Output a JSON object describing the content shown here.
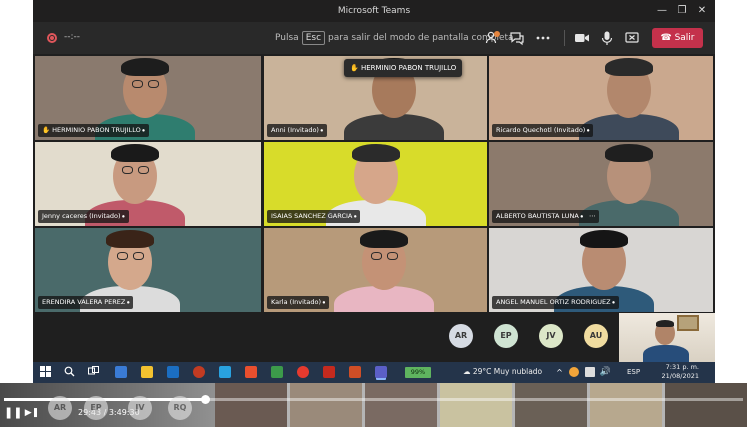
{
  "window": {
    "title": "Microsoft Teams",
    "minimize": "—",
    "restore": "❐",
    "close": "✕"
  },
  "toolbar": {
    "timer": "--:--",
    "hint_prefix": "Pulsa",
    "hint_key": "Esc",
    "hint_suffix": "para salir del modo de pantalla completa",
    "leave_label": "Salir",
    "participants_badge": "1"
  },
  "tooltip": {
    "name": "HERMINIO PABON TRUJILLO"
  },
  "participants": [
    {
      "name": "HERMINIO PABON TRUJILLO",
      "hand_raised": true,
      "bg": "#8a7a6e",
      "skin": "#b88a6e",
      "shirt": "#2f7d6f",
      "hair": "#1d1d1d",
      "glasses": true
    },
    {
      "name": "Anni (Invitado)",
      "hand_raised": false,
      "bg": "#c9b39a",
      "skin": "#a77a5c",
      "shirt": "#3b3b3b",
      "hair": "#1a1a1a",
      "glasses": false
    },
    {
      "name": "Ricardo Quechotl (Invitado)",
      "hand_raised": false,
      "bg": "#caa88e",
      "skin": "#b2876c",
      "shirt": "#3e4a5a",
      "hair": "#2a2a2a",
      "glasses": false
    },
    {
      "name": "Jenny caceres (Invitado)",
      "hand_raised": false,
      "bg": "#e2dccd",
      "skin": "#c89a80",
      "shirt": "#c05a6a",
      "hair": "#1a1a1a",
      "glasses": true
    },
    {
      "name": "ISAIAS SANCHEZ GARCIA",
      "hand_raised": false,
      "bg": "#d8dc2a",
      "skin": "#d6a68a",
      "shirt": "#e8e8e8",
      "hair": "#2b2b2b",
      "glasses": false
    },
    {
      "name": "ALBERTO BAUTISTA LUNA",
      "hand_raised": false,
      "bg": "#8c7a6c",
      "skin": "#b7917a",
      "shirt": "#4a6a6a",
      "hair": "#1f1f1f",
      "glasses": false
    },
    {
      "name": "ERENDIRA VALERA PEREZ",
      "hand_raised": false,
      "bg": "#4a6a6a",
      "skin": "#d4a88c",
      "shirt": "#dcdcdc",
      "hair": "#3a2418",
      "glasses": true
    },
    {
      "name": "Karla (Invitado)",
      "hand_raised": false,
      "bg": "#b79a7a",
      "skin": "#c49276",
      "shirt": "#e8b6c2",
      "hair": "#1a1a1a",
      "glasses": true
    },
    {
      "name": "ANGEL MANUEL ORTIZ RODRIGUEZ",
      "hand_raised": false,
      "bg": "#d8d6d3",
      "skin": "#b98c72",
      "shirt": "#2e5a7a",
      "hair": "#151515",
      "glasses": false
    }
  ],
  "more_icon": "⋯",
  "avatar_row": [
    {
      "initials": "AR",
      "color": "#d6dbe3"
    },
    {
      "initials": "EP",
      "color": "#cfe3d2"
    },
    {
      "initials": "JV",
      "color": "#dce7c8"
    },
    {
      "initials": "AU",
      "color": "#f0dca0"
    }
  ],
  "taskbar": {
    "battery": "99%",
    "weather": "29°C  Muy nublado",
    "lang": "ESP",
    "time": "7:31 p. m.",
    "date": "21/08/2021"
  },
  "player": {
    "time": "29:43 / 3:49:30",
    "progress": 0.272,
    "play_icon": "❚❚",
    "next_icon": "▶❚",
    "avatars": [
      "AR",
      "EP",
      "JV",
      "RQ"
    ]
  }
}
